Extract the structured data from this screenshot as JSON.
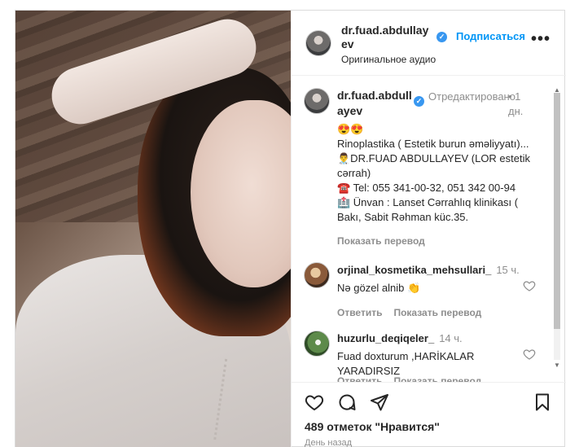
{
  "post": {
    "username": "dr.fuad.abdullayev",
    "follow_label": "Подписаться",
    "more_label": "•••",
    "audio_label": "Оригинальное аудио"
  },
  "caption": {
    "username": "dr.fuad.abdullayev",
    "edited_label": "Отредактировано",
    "time": "• 1 дн.",
    "lines": [
      "😍😍",
      "Rinoplastika ( Estetik burun əməliyyatı)...",
      "👨‍⚕️DR.FUAD ABDULLAYEV (LOR estetik cərrah)",
      "☎️ Tel: 055 341-00-32, 051 342 00-94",
      "🏥 Ünvan : Lanset Cərrahlıq klinikası ( Bakı, Sabit Rəhman küc.35."
    ],
    "translate_label": "Показать перевод"
  },
  "comments": [
    {
      "username": "orjinal_kosmetika_mehsullari_",
      "time": "15 ч.",
      "text": "Nə gözel alnib 👏",
      "reply_label": "Ответить",
      "translate_label": "Показать перевод"
    },
    {
      "username": "huzurlu_deqiqeler_",
      "time": "14 ч.",
      "text": "Fuad doxturum ,HARİKALAR YARADIRSIZ",
      "reply_label": "Ответить",
      "translate_label": "Показать перевод"
    }
  ],
  "footer": {
    "likes": "489 отметок \"Нравится\"",
    "ago": "День назад"
  },
  "icons": {
    "verified": "verified-badge-icon",
    "like": "heart-icon",
    "comment": "comment-bubble-icon",
    "share": "paper-plane-icon",
    "save": "bookmark-icon"
  },
  "colors": {
    "accent": "#0095f6",
    "verified": "#3897f0",
    "muted": "#8e8e8e"
  }
}
